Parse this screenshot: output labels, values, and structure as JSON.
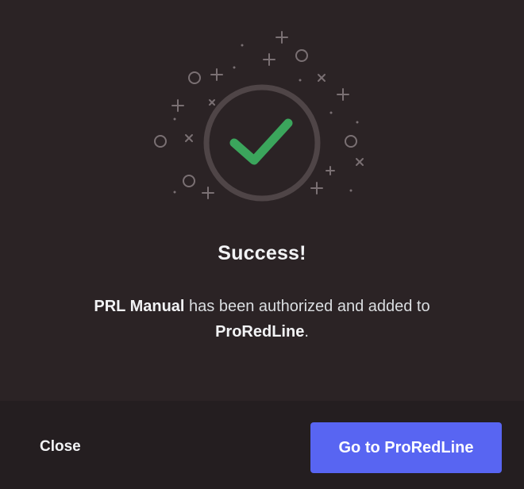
{
  "dialog": {
    "title": "Success!",
    "message": {
      "app_name": "PRL Manual",
      "middle_text": " has been authorized and added to ",
      "server_name": "ProRedLine",
      "end_text": "."
    },
    "illustration_icon": "checkmark-success",
    "colors": {
      "check": "#3ba55c",
      "ring": "#4f4547",
      "accent": "#5865f2"
    }
  },
  "footer": {
    "close_label": "Close",
    "primary_label": "Go to ProRedLine"
  }
}
